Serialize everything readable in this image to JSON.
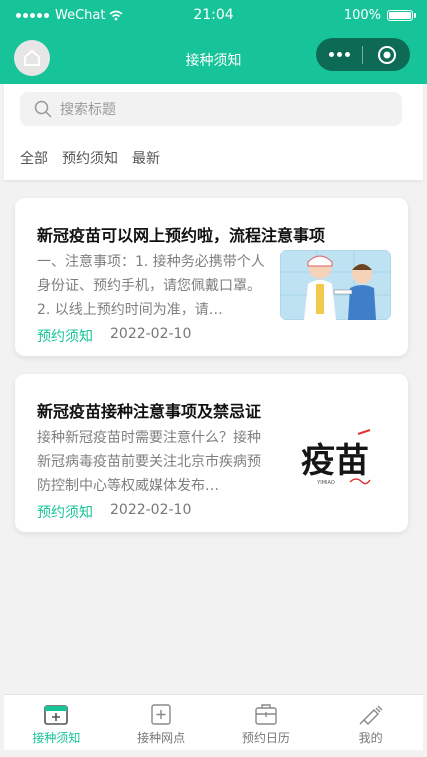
{
  "status_bar": {
    "carrier": "WeChat",
    "time": "21:04",
    "battery": "100%"
  },
  "navbar": {
    "title": "接种须知",
    "home_icon": "home-icon",
    "more_icon": "more-dots-icon",
    "close_icon": "target-icon"
  },
  "search": {
    "placeholder": "搜索标题"
  },
  "filter_tabs": [
    "全部",
    "预约须知",
    "最新"
  ],
  "articles": [
    {
      "title": "新冠疫苗可以网上预约啦，流程注意事项",
      "desc": "一、注意事项：1. 接种务必携带个人身份证、预约手机，请您佩戴口罩。2. 以线上预约时间为准，请…",
      "tag": "预约须知",
      "date": "2022-02-10"
    },
    {
      "title": "新冠疫苗接种注意事项及禁忌证",
      "desc": "接种新冠疫苗时需要注意什么？接种新冠病毒疫苗前要关注北京市疾病预防控制中心等权威媒体发布…",
      "tag": "预约须知",
      "date": "2022-02-10",
      "thumb_text": "疫苗",
      "thumb_sub": "YIMIAO"
    }
  ],
  "tabbar": [
    {
      "label": "接种须知",
      "icon": "notice-icon",
      "active": true
    },
    {
      "label": "接种网点",
      "icon": "clinic-icon",
      "active": false
    },
    {
      "label": "预约日历",
      "icon": "calendar-kit-icon",
      "active": false
    },
    {
      "label": "我的",
      "icon": "syringe-icon",
      "active": false
    }
  ],
  "colors": {
    "accent": "#17c499",
    "capsule": "#0d6b55",
    "background": "#f2f2f2"
  }
}
